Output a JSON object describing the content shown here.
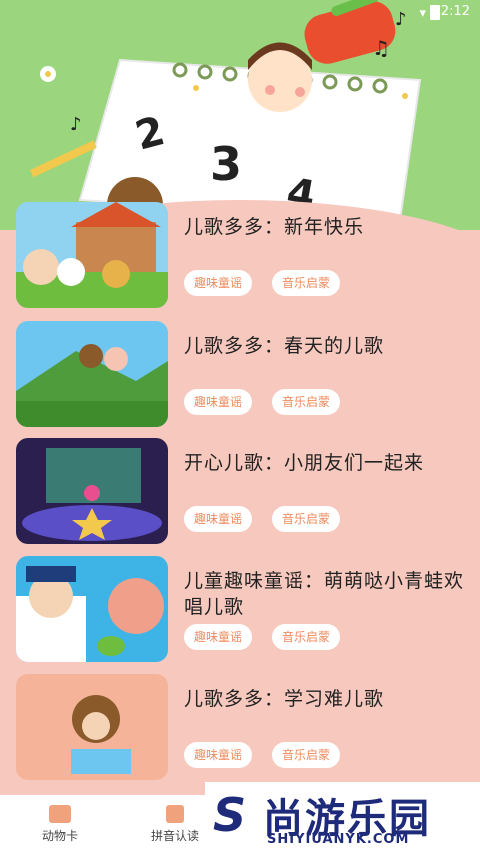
{
  "status": {
    "time": "2:12"
  },
  "items": [
    {
      "title": "儿歌多多：新年快乐",
      "tags": [
        "趣味童谣",
        "音乐启蒙"
      ]
    },
    {
      "title": "儿歌多多：春天的儿歌",
      "tags": [
        "趣味童谣",
        "音乐启蒙"
      ]
    },
    {
      "title": "开心儿歌：小朋友们一起来",
      "tags": [
        "趣味童谣",
        "音乐启蒙"
      ]
    },
    {
      "title": "儿童趣味童谣：萌萌哒小青蛙欢唱儿歌",
      "tags": [
        "趣味童谣",
        "音乐启蒙"
      ]
    },
    {
      "title": "儿歌多多：学习难儿歌",
      "tags": [
        "趣味童谣",
        "音乐启蒙"
      ]
    }
  ],
  "tabs": [
    {
      "label": "动物卡",
      "icon": "card-icon"
    },
    {
      "label": "拼音认读",
      "icon": "pinyin-icon"
    }
  ],
  "watermark": {
    "brand": "尚游乐园",
    "url": "SHIYIUANYK.COM"
  },
  "colors": {
    "background": "#f7c8bd",
    "header": "#9bd57d",
    "tag_text": "#f08a5d"
  }
}
